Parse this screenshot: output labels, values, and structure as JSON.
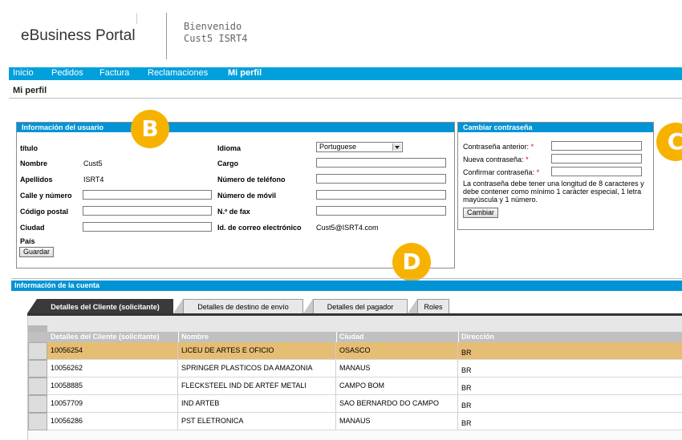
{
  "header": {
    "brand": "eBusiness Portal",
    "welcome": "Bienvenido",
    "user": "Cust5 ISRT4"
  },
  "nav": {
    "items": [
      "Inicio",
      "Pedidos",
      "Factura",
      "Reclamaciones",
      "Mi perfil"
    ],
    "active": "Mi perfil"
  },
  "breadcrumb": "Mi perfil",
  "user_info": {
    "title": "Información del usuario",
    "fields_left": {
      "titulo_label": "título",
      "nombre_label": "Nombre",
      "nombre_value": "Cust5",
      "apellidos_label": "Apellidos",
      "apellidos_value": "ISRT4",
      "calle_label": "Calle y número",
      "postal_label": "Código postal",
      "ciudad_label": "Ciudad",
      "pais_label": "País"
    },
    "fields_right": {
      "idioma_label": "Idioma",
      "idioma_value": "Portuguese",
      "cargo_label": "Cargo",
      "telefono_label": "Número de teléfono",
      "movil_label": "Número de móvil",
      "fax_label": "N.º de fax",
      "email_label": "Id. de correo electrónico",
      "email_value": "Cust5@ISRT4.com"
    },
    "save_button": "Guardar"
  },
  "password": {
    "title": "Cambiar contraseña",
    "old_label": "Contraseña anterior:",
    "new_label": "Nueva contraseña:",
    "confirm_label": "Confirmar contraseña:",
    "required_mark": "*",
    "note": "La contraseña debe tener una longitud de 8 caracteres y debe contener como mínimo 1 carácter especial, 1 letra mayúscula y 1 número.",
    "change_button": "Cambiar"
  },
  "badges": {
    "b": "B",
    "c": "C",
    "d": "D",
    "color": "#f7b200"
  },
  "account": {
    "title": "Información de la cuenta",
    "tabs": [
      "Detalles del Cliente (solicitante)",
      "Detalles de destino de envío",
      "Detalles del pagador",
      "Roles"
    ],
    "active_tab": "Detalles del Cliente (solicitante)",
    "columns": [
      "Detalles del Cliente (solicitante)",
      "Nombre",
      "Ciudad",
      "Dirección"
    ],
    "rows": [
      [
        "10056254",
        "LICEU DE ARTES E OFICIO",
        "OSASCO",
        "BR"
      ],
      [
        "10056262",
        "SPRINGER PLASTICOS DA AMAZONIA",
        "MANAUS",
        "BR"
      ],
      [
        "10058885",
        "FLECKSTEEL IND DE ARTEF METALI",
        "CAMPO BOM",
        "BR"
      ],
      [
        "10057709",
        "IND ARTEB",
        "SAO BERNARDO DO CAMPO",
        "BR"
      ],
      [
        "10056286",
        "PST ELETRONICA",
        "MANAUS",
        "BR"
      ]
    ],
    "highlight_color": "#e6bd74"
  },
  "colors": {
    "nav": "#00a0dc",
    "panel_bar": "#0093d6"
  }
}
